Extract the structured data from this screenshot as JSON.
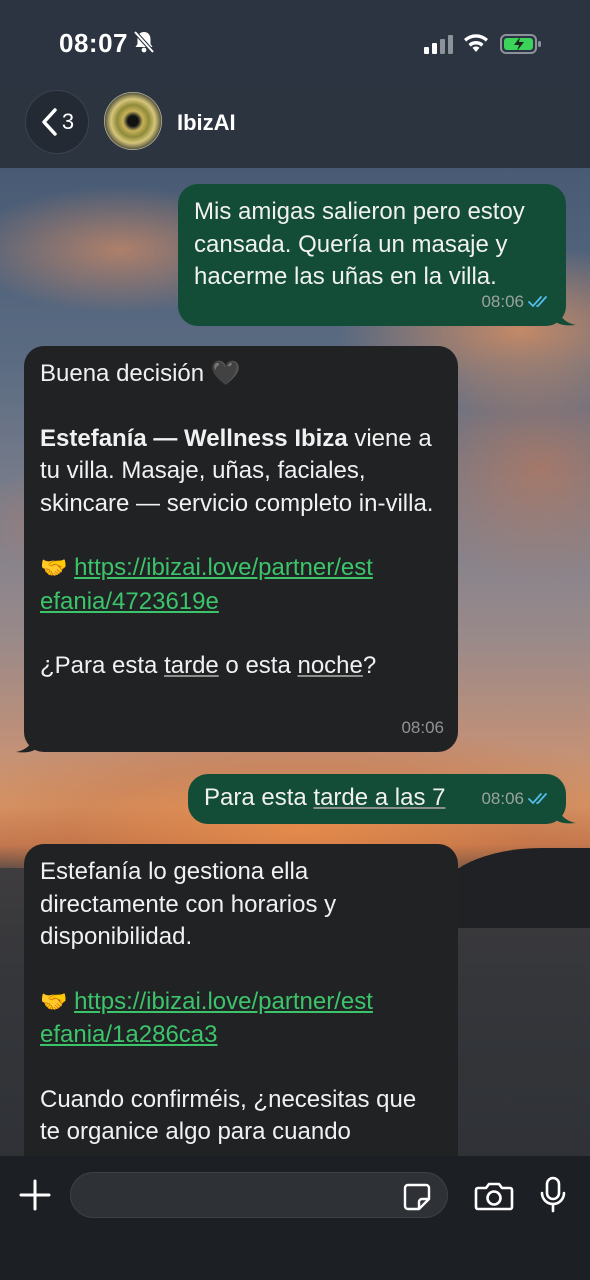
{
  "status_bar": {
    "time": "08:07"
  },
  "header": {
    "back_count": "3",
    "contact_name": "IbizAI"
  },
  "messages": [
    {
      "dir": "out",
      "text": "Mis amigas salieron pero estoy cansada. Quería un masaje y hacerme las uñas en la villa.",
      "time": "08:06"
    },
    {
      "dir": "in",
      "greeting": "Buena decisión 🖤",
      "bold_name": "Estefanía — Wellness Ibiza",
      "body": " viene a tu villa. Masaje, uñas, faciales, skincare — servicio completo in-villa.",
      "link_emoji": "🤝",
      "link": "https://ibizai.love/partner/estefania/4723619e",
      "question_a": "¿Para esta ",
      "question_u1": "tarde",
      "question_b": " o esta ",
      "question_u2": "noche",
      "question_c": "?",
      "time": "08:06"
    },
    {
      "dir": "out",
      "text_a": "Para esta ",
      "text_u": "tarde a las 7",
      "time": "08:06"
    },
    {
      "dir": "in",
      "body": "Estefanía lo gestiona ella directamente con horarios y disponibilidad.",
      "link_emoji": "🤝",
      "link": "https://ibizai.love/partner/estefania/1a286ca3",
      "followup": "Cuando confirméis, ¿necesitas que te organice algo para cuando"
    }
  ],
  "composer": {
    "placeholder": ""
  },
  "colors": {
    "outgoing": "#134d37",
    "incoming": "#202224",
    "link": "#3cc46b",
    "read_ticks": "#53bdeb"
  }
}
